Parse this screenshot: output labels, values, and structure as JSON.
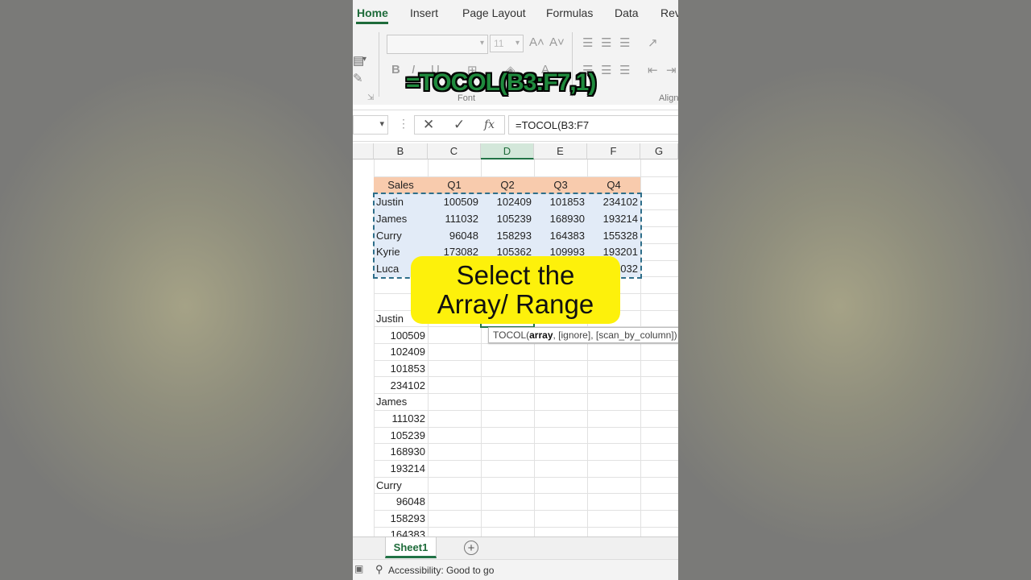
{
  "ribbon": {
    "tabs": [
      "Home",
      "Insert",
      "Page Layout",
      "Formulas",
      "Data",
      "Rev"
    ],
    "font_size": "11",
    "group_font": "Font",
    "group_align": "Align"
  },
  "overlay_formula": "=TOCOL(B3:F7,1)",
  "formula_bar": {
    "name_box": "",
    "cancel_icon": "✕",
    "enter_icon": "✓",
    "fx_label": "fx",
    "formula": "=TOCOL(B3:F7"
  },
  "columns": [
    "B",
    "C",
    "D",
    "E",
    "F",
    "G"
  ],
  "table": {
    "headers": [
      "Sales",
      "Q1",
      "Q2",
      "Q3",
      "Q4"
    ],
    "rows": [
      [
        "Justin",
        "100509",
        "102409",
        "101853",
        "234102"
      ],
      [
        "James",
        "111032",
        "105239",
        "168930",
        "193214"
      ],
      [
        "Curry",
        "96048",
        "158293",
        "164383",
        "155328"
      ],
      [
        "Kyrie",
        "173082",
        "105362",
        "109993",
        "193201"
      ],
      [
        "Luca",
        "",
        "",
        "",
        "032"
      ]
    ]
  },
  "output_list": [
    "Justin",
    "100509",
    "102409",
    "101853",
    "234102",
    "James",
    "111032",
    "105239",
    "168930",
    "193214",
    "Curry",
    "96048",
    "158293",
    "164383"
  ],
  "tooltip": {
    "fn": "TOCOL(",
    "arg1": "array",
    "rest": ", [ignore], [scan_by_column])"
  },
  "callout": {
    "line1": "Select the",
    "line2": "Array/ Range"
  },
  "sheet_tab": "Sheet1",
  "status": "Accessibility: Good to go",
  "colors": {
    "excel_green": "#217346",
    "header_fill": "#f8cbad",
    "callout_fill": "#fdf10b"
  }
}
